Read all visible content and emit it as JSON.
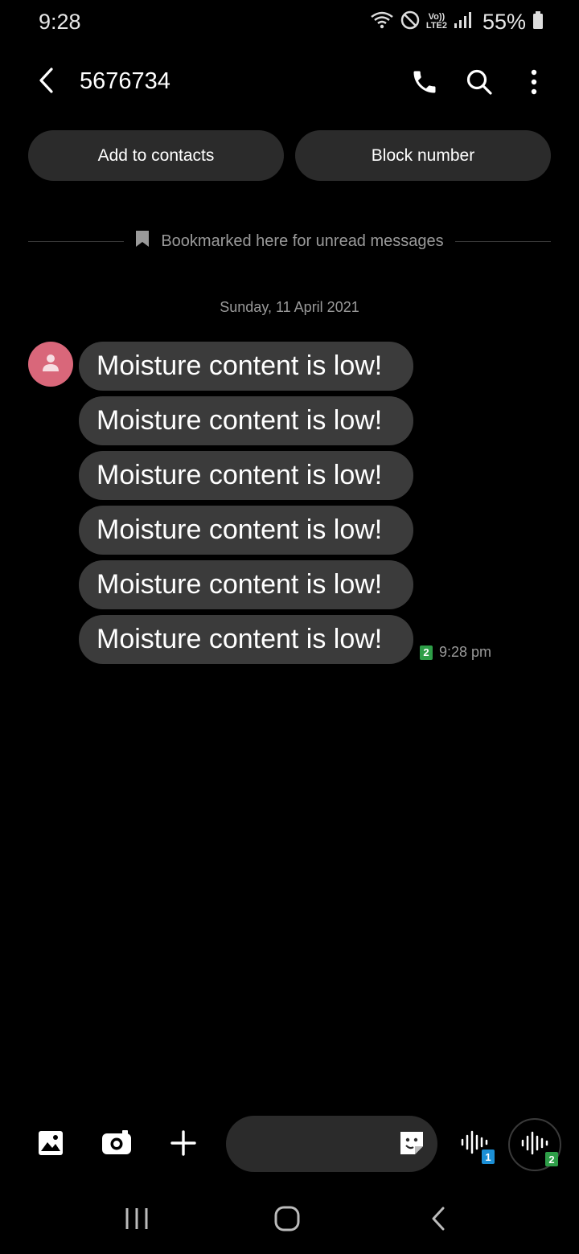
{
  "status_bar": {
    "time": "9:28",
    "battery_percent": "55%",
    "network_label_top": "Vo))",
    "network_label_bottom": "LTE2"
  },
  "header": {
    "title": "5676734"
  },
  "actions": {
    "add_contact": "Add to contacts",
    "block_number": "Block number"
  },
  "bookmark": {
    "text": "Bookmarked here for unread messages"
  },
  "conversation": {
    "date": "Sunday, 11 April 2021",
    "messages": [
      {
        "text": "Moisture content is low!"
      },
      {
        "text": "Moisture content is low!"
      },
      {
        "text": "Moisture content is low!"
      },
      {
        "text": "Moisture content is low!"
      },
      {
        "text": "Moisture content is low!"
      },
      {
        "text": "Moisture content is low!"
      }
    ],
    "last_time": "9:28 pm",
    "sim_slot": "2"
  },
  "compose": {
    "placeholder": "",
    "sim1_label": "1",
    "sim2_label": "2"
  },
  "colors": {
    "background": "#000000",
    "bubble": "#3b3b3b",
    "button": "#2b2b2b",
    "avatar": "#d9677a",
    "sim2_badge": "#2e9e48",
    "sim1_badge": "#1b8fd6"
  }
}
